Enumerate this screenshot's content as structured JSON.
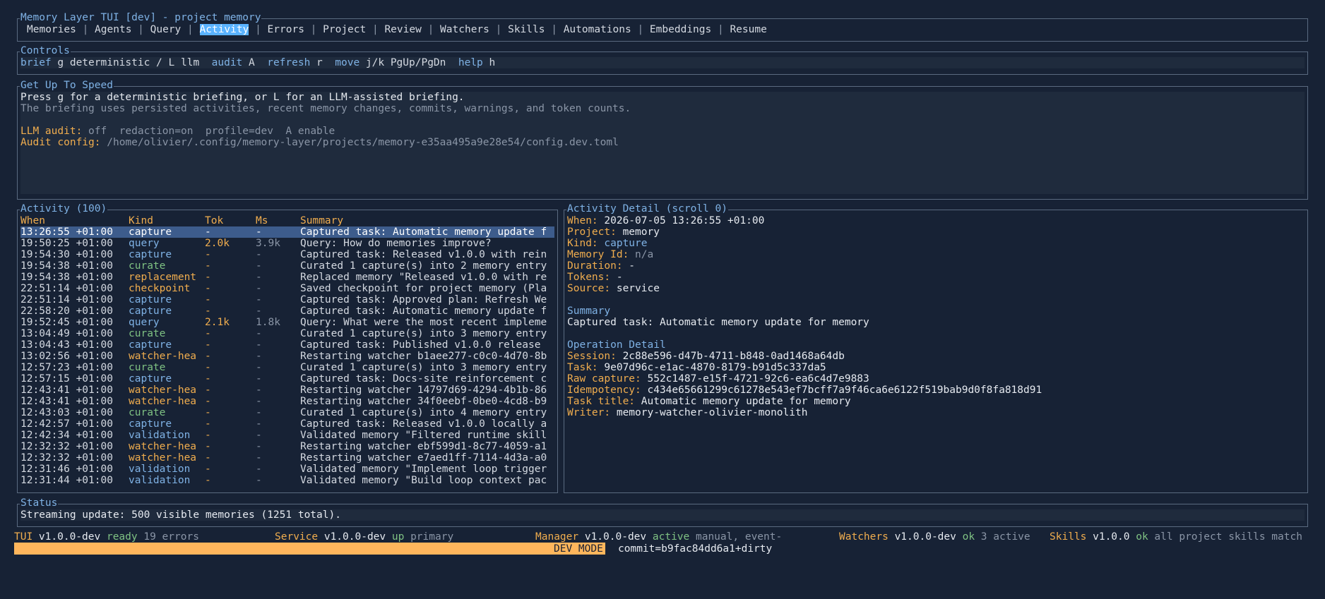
{
  "window_title": "Memory Layer TUI [dev] - project memory",
  "tabs": [
    "Memories",
    "Agents",
    "Query",
    "Activity",
    "Errors",
    "Project",
    "Review",
    "Watchers",
    "Skills",
    "Automations",
    "Embeddings",
    "Resume"
  ],
  "active_tab": "Activity",
  "controls": {
    "title": "Controls",
    "brief_key": "brief",
    "brief_val": " g deterministic / L llm  ",
    "audit_key": "audit",
    "audit_val": " A  ",
    "refresh_key": "refresh",
    "refresh_val": " r  ",
    "move_key": "move",
    "move_val": " j/k PgUp/PgDn  ",
    "help_key": "help",
    "help_val": " h"
  },
  "speed": {
    "title": "Get Up To Speed",
    "line1": "Press g for a deterministic briefing, or L for an LLM-assisted briefing.",
    "line2": "The briefing uses persisted activities, recent memory changes, commits, warnings, and token counts.",
    "audit_label": "LLM audit:",
    "audit_value": " off  redaction=on  profile=dev  A enable",
    "config_label": "Audit config:",
    "config_value": " /home/olivier/.config/memory-layer/projects/memory-e35aa495a9e28e54/config.dev.toml"
  },
  "activity": {
    "title": "Activity (100)",
    "headers": {
      "when": "When",
      "kind": "Kind",
      "tok": "Tok",
      "ms": "Ms",
      "summary": "Summary"
    },
    "rows": [
      {
        "when": "13:26:55 +01:00",
        "kind": "capture",
        "tok": "-",
        "ms": "-",
        "summary": "Captured task: Automatic memory update f",
        "kc": "blue",
        "tc": "orange",
        "selected": true
      },
      {
        "when": "19:50:25 +01:00",
        "kind": "query",
        "tok": "2.0k",
        "ms": "3.9k",
        "summary": "Query: How do memories improve?",
        "kc": "blue",
        "tc": "orange"
      },
      {
        "when": "19:54:30 +01:00",
        "kind": "capture",
        "tok": "-",
        "ms": "-",
        "summary": "Captured task: Released v1.0.0 with rein",
        "kc": "blue",
        "tc": "orange"
      },
      {
        "when": "19:54:38 +01:00",
        "kind": "curate",
        "tok": "-",
        "ms": "-",
        "summary": "Curated 1 capture(s) into 2 memory entry",
        "kc": "green",
        "tc": "orange"
      },
      {
        "when": "19:54:38 +01:00",
        "kind": "replacement",
        "tok": "-",
        "ms": "-",
        "summary": "Replaced memory \"Released v1.0.0 with re",
        "kc": "orange",
        "tc": "orange"
      },
      {
        "when": "22:51:14 +01:00",
        "kind": "checkpoint",
        "tok": "-",
        "ms": "-",
        "summary": "Saved checkpoint for project memory (Pla",
        "kc": "orange",
        "tc": "orange"
      },
      {
        "when": "22:51:14 +01:00",
        "kind": "capture",
        "tok": "-",
        "ms": "-",
        "summary": "Captured task: Approved plan: Refresh We",
        "kc": "blue",
        "tc": "orange"
      },
      {
        "when": "22:58:20 +01:00",
        "kind": "capture",
        "tok": "-",
        "ms": "-",
        "summary": "Captured task: Automatic memory update f",
        "kc": "blue",
        "tc": "orange"
      },
      {
        "when": "19:52:45 +01:00",
        "kind": "query",
        "tok": "2.1k",
        "ms": "1.8k",
        "summary": "Query: What were the most recent impleme",
        "kc": "blue",
        "tc": "orange"
      },
      {
        "when": "13:04:49 +01:00",
        "kind": "curate",
        "tok": "-",
        "ms": "-",
        "summary": "Curated 1 capture(s) into 3 memory entry",
        "kc": "green",
        "tc": "orange"
      },
      {
        "when": "13:04:43 +01:00",
        "kind": "capture",
        "tok": "-",
        "ms": "-",
        "summary": "Captured task: Published v1.0.0 release ",
        "kc": "blue",
        "tc": "orange"
      },
      {
        "when": "13:02:56 +01:00",
        "kind": "watcher-hea",
        "tok": "-",
        "ms": "-",
        "summary": "Restarting watcher b1aee277-c0c0-4d70-8b",
        "kc": "orange",
        "tc": "orange"
      },
      {
        "when": "12:57:23 +01:00",
        "kind": "curate",
        "tok": "-",
        "ms": "-",
        "summary": "Curated 1 capture(s) into 3 memory entry",
        "kc": "green",
        "tc": "orange"
      },
      {
        "when": "12:57:15 +01:00",
        "kind": "capture",
        "tok": "-",
        "ms": "-",
        "summary": "Captured task: Docs-site reinforcement c",
        "kc": "blue",
        "tc": "orange"
      },
      {
        "when": "12:43:41 +01:00",
        "kind": "watcher-hea",
        "tok": "-",
        "ms": "-",
        "summary": "Restarting watcher 14797d69-4294-4b1b-86",
        "kc": "orange",
        "tc": "orange"
      },
      {
        "when": "12:43:41 +01:00",
        "kind": "watcher-hea",
        "tok": "-",
        "ms": "-",
        "summary": "Restarting watcher 34f0eebf-0be0-4cd8-b9",
        "kc": "orange",
        "tc": "orange"
      },
      {
        "when": "12:43:03 +01:00",
        "kind": "curate",
        "tok": "-",
        "ms": "-",
        "summary": "Curated 1 capture(s) into 4 memory entry",
        "kc": "green",
        "tc": "orange"
      },
      {
        "when": "12:42:57 +01:00",
        "kind": "capture",
        "tok": "-",
        "ms": "-",
        "summary": "Captured task: Released v1.0.0 locally a",
        "kc": "blue",
        "tc": "orange"
      },
      {
        "when": "12:42:34 +01:00",
        "kind": "validation",
        "tok": "-",
        "ms": "-",
        "summary": "Validated memory \"Filtered runtime skill",
        "kc": "blue",
        "tc": "orange"
      },
      {
        "when": "12:32:32 +01:00",
        "kind": "watcher-hea",
        "tok": "-",
        "ms": "-",
        "summary": "Restarting watcher ebf599d1-8c77-4059-a1",
        "kc": "orange",
        "tc": "orange"
      },
      {
        "when": "12:32:32 +01:00",
        "kind": "watcher-hea",
        "tok": "-",
        "ms": "-",
        "summary": "Restarting watcher e7aed1ff-7114-4d3a-a0",
        "kc": "orange",
        "tc": "orange"
      },
      {
        "when": "12:31:46 +01:00",
        "kind": "validation",
        "tok": "-",
        "ms": "-",
        "summary": "Validated memory \"Implement loop trigger",
        "kc": "blue",
        "tc": "orange"
      },
      {
        "when": "12:31:44 +01:00",
        "kind": "validation",
        "tok": "-",
        "ms": "-",
        "summary": "Validated memory \"Build loop context pac",
        "kc": "blue",
        "tc": "orange"
      }
    ]
  },
  "detail": {
    "title": "Activity Detail (scroll 0)",
    "fields": [
      {
        "label": "When:",
        "value": " 2026-07-05 13:26:55 +01:00",
        "vc": "white"
      },
      {
        "label": "Project:",
        "value": " memory",
        "vc": "white"
      },
      {
        "label": "Kind:",
        "value": " capture",
        "vc": "blue"
      },
      {
        "label": "Memory Id:",
        "value": " n/a",
        "vc": "grey"
      },
      {
        "label": "Duration:",
        "value": " -",
        "vc": "white"
      },
      {
        "label": "Tokens:",
        "value": " -",
        "vc": "white"
      },
      {
        "label": "Source:",
        "value": " service",
        "vc": "white"
      }
    ],
    "summary_heading": "Summary",
    "summary_text": "Captured task: Automatic memory update for memory",
    "op_heading": "Operation Detail",
    "op_fields": [
      {
        "label": "Session:",
        "value": " 2c88e596-d47b-4711-b848-0ad1468a64db"
      },
      {
        "label": "Task:",
        "value": " 9e07d96c-e1ac-4870-8179-b91d5c337da5"
      },
      {
        "label": "Raw capture:",
        "value": " 552c1487-e15f-4721-92c6-ea6c4d7e9883"
      },
      {
        "label": "Idempotency:",
        "value": " c434e65661299c61278e543ef7bcff7a9f46ca6e6122f519bab9d0f8fa818d91"
      },
      {
        "label": "Task title:",
        "value": " Automatic memory update for memory"
      },
      {
        "label": "Writer:",
        "value": " memory-watcher-olivier-monolith"
      }
    ]
  },
  "status": {
    "title": "Status",
    "text": "Streaming update: 500 visible memories (1251 total)."
  },
  "footer": {
    "tui_label": "TUI",
    "tui_ver": " v1.0.0-dev ",
    "tui_state": "ready",
    "tui_extra": " 19 errors",
    "svc_label": "Service",
    "svc_ver": " v1.0.0-dev ",
    "svc_state": "up",
    "svc_extra": " primary",
    "mgr_label": "Manager",
    "mgr_ver": " v1.0.0-dev ",
    "mgr_state": "active",
    "mgr_extra": " manual, event-",
    "wat_label": "Watchers",
    "wat_ver": " v1.0.0-dev ",
    "wat_state": "ok",
    "wat_extra": " 3 active",
    "sk_label": "Skills",
    "sk_ver": " v1.0.0 ",
    "sk_state": "ok",
    "sk_extra": " all project skills match",
    "dev_mode": "DEV MODE",
    "commit": "commit=b9fac84dd6a1+dirty"
  },
  "colors": {
    "background": "#172235",
    "accent": "#5ab3ff",
    "label": "#f0ad4e",
    "ok": "#7fc283",
    "dev_bar": "#ffb65c"
  }
}
